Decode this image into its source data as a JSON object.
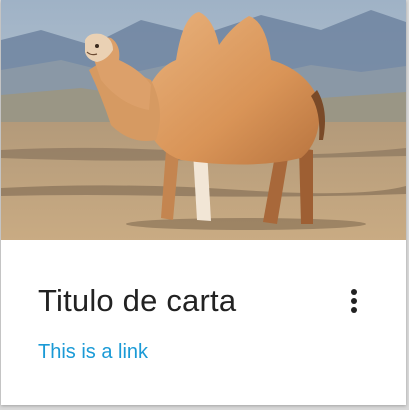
{
  "card": {
    "image_alt": "Bactrian camel standing in a desert steppe",
    "title": "Titulo de carta",
    "link_text": "This is a link",
    "menu_icon": "more-vertical-icon",
    "colors": {
      "title": "#222222",
      "link": "#1a9ad6",
      "card_bg": "#ffffff"
    }
  }
}
